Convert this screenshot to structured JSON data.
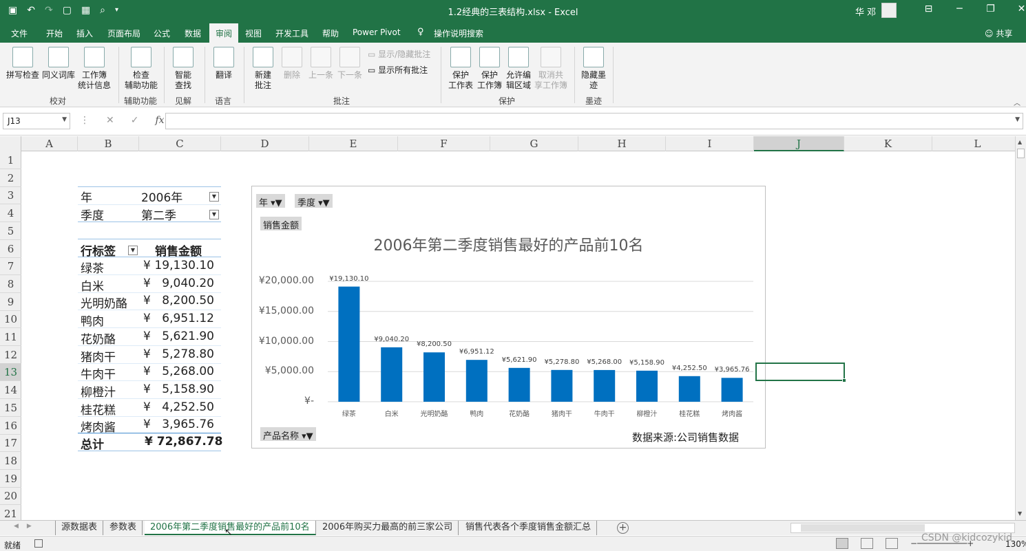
{
  "window": {
    "title": "1.2经典的三表结构.xlsx  -  Excel",
    "user": "华 邓",
    "qat_icons": [
      "save-icon",
      "undo-icon",
      "redo-icon",
      "new-icon",
      "screenshot-icon",
      "print-preview-icon",
      "customize-icon"
    ]
  },
  "ribbon_tabs": [
    "文件",
    "开始",
    "插入",
    "页面布局",
    "公式",
    "数据",
    "审阅",
    "视图",
    "开发工具",
    "帮助",
    "Power Pivot",
    "操作说明搜索"
  ],
  "active_tab": "审阅",
  "share_label": "共享",
  "ribbon": {
    "groups": {
      "proofing": "校对",
      "accessibility": "辅助功能",
      "insights": "见解",
      "language": "语言",
      "comments": "批注",
      "protect": "保护",
      "ink": "墨迹"
    },
    "buttons": {
      "spell_check": "拼写检查",
      "thesaurus": "同义词库",
      "workbook_stats_1": "工作簿",
      "workbook_stats_2": "统计信息",
      "check_access_1": "检查",
      "check_access_2": "辅助功能",
      "smart_lookup_1": "智能",
      "smart_lookup_2": "查找",
      "translate": "翻译",
      "new_comment_1": "新建",
      "new_comment_2": "批注",
      "delete": "删除",
      "previous": "上一条",
      "next": "下一条",
      "show_hide_comment": "显示/隐藏批注",
      "show_all_comments": "显示所有批注",
      "protect_sheet_1": "保护",
      "protect_sheet_2": "工作表",
      "protect_workbook_1": "保护",
      "protect_workbook_2": "工作簿",
      "allow_edit_1": "允许编",
      "allow_edit_2": "辑区域",
      "unshare_1": "取消共",
      "unshare_2": "享工作簿",
      "hide_ink_1": "隐藏墨",
      "hide_ink_2": "迹"
    }
  },
  "formula_bar": {
    "name_box": "J13",
    "formula": ""
  },
  "columns": [
    "A",
    "B",
    "C",
    "D",
    "E",
    "F",
    "G",
    "H",
    "I",
    "J",
    "K",
    "L"
  ],
  "selected_column": "J",
  "rows": [
    "1",
    "2",
    "3",
    "4",
    "5",
    "6",
    "7",
    "8",
    "9",
    "10",
    "11",
    "12",
    "13",
    "14",
    "15",
    "16",
    "17",
    "18",
    "19",
    "20",
    "21"
  ],
  "selected_row": "13",
  "pivot": {
    "filters": [
      {
        "label": "年",
        "value": "2006年"
      },
      {
        "label": "季度",
        "value": "第二季"
      }
    ],
    "header_row": "行标签",
    "header_value": "销售金额",
    "currency": "¥",
    "rows": [
      {
        "name": "绿茶",
        "value": "19,130.10"
      },
      {
        "name": "白米",
        "value": "9,040.20"
      },
      {
        "name": "光明奶酪",
        "value": "8,200.50"
      },
      {
        "name": "鸭肉",
        "value": "6,951.12"
      },
      {
        "name": "花奶酪",
        "value": "5,621.90"
      },
      {
        "name": "猪肉干",
        "value": "5,278.80"
      },
      {
        "name": "牛肉干",
        "value": "5,268.00"
      },
      {
        "name": "柳橙汁",
        "value": "5,158.90"
      },
      {
        "name": "桂花糕",
        "value": "4,252.50"
      },
      {
        "name": "烤肉酱",
        "value": "3,965.76"
      }
    ],
    "total_label": "总计",
    "total_value": "¥  72,867.78"
  },
  "chart_data": {
    "type": "bar",
    "title": "2006年第二季度销售最好的产品前10名",
    "field_buttons": {
      "year": "年",
      "quarter": "季度",
      "value": "销售金额",
      "axis": "产品名称"
    },
    "categories": [
      "绿茶",
      "白米",
      "光明奶酪",
      "鸭肉",
      "花奶酪",
      "猪肉干",
      "牛肉干",
      "柳橙汁",
      "桂花糕",
      "烤肉酱"
    ],
    "values": [
      19130.1,
      9040.2,
      8200.5,
      6951.12,
      5621.9,
      5278.8,
      5268.0,
      5158.9,
      4252.5,
      3965.76
    ],
    "data_labels": [
      "¥19,130.10",
      "¥9,040.20",
      "¥8,200.50",
      "¥6,951.12",
      "¥5,621.90",
      "¥5,278.80",
      "¥5,268.00",
      "¥5,158.90",
      "¥4,252.50",
      "¥3,965.76"
    ],
    "y_ticks": [
      "¥-",
      "¥5,000.00",
      "¥10,000.00",
      "¥15,000.00",
      "¥20,000.00"
    ],
    "ylim": [
      0,
      20000
    ],
    "grid": true,
    "bar_color": "#0070c0",
    "source_note": "数据来源:公司销售数据"
  },
  "sheet_tabs": [
    "源数据表",
    "参数表",
    "2006年第二季度销售最好的产品前10名",
    "2006年购买力最高的前三家公司",
    "销售代表各个季度销售金额汇总"
  ],
  "active_sheet": "2006年第二季度销售最好的产品前10名",
  "status": {
    "ready": "就绪",
    "zoom": "130%"
  },
  "watermark": "CSDN @kidcozykid",
  "colors": {
    "accent": "#217346",
    "bar": "#0070c0"
  }
}
